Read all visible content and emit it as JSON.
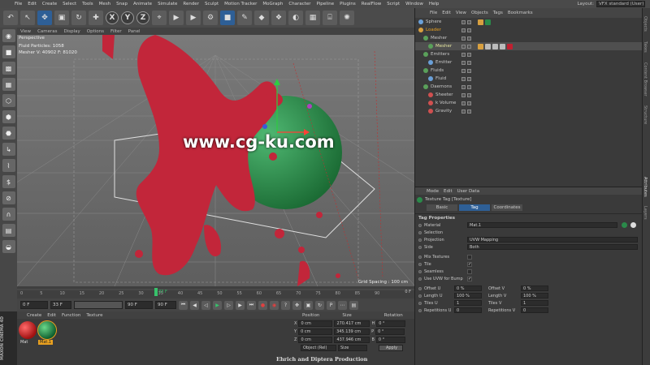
{
  "menu": [
    "File",
    "Edit",
    "Create",
    "Select",
    "Tools",
    "Mesh",
    "Snap",
    "Animate",
    "Simulate",
    "Render",
    "Sculpt",
    "Motion Tracker",
    "MoGraph",
    "Character",
    "Pipeline",
    "Plugins",
    "RealFlow",
    "Script",
    "Window",
    "Help"
  ],
  "layout": {
    "label": "Layout:",
    "value": "VFX standard (User)"
  },
  "viewport": {
    "menu": [
      "View",
      "Cameras",
      "Display",
      "Options",
      "Filter",
      "Panel"
    ],
    "name": "Perspective",
    "stat1": "Fluid Particles: 1058",
    "stat2": "Mesher V: 40902 F: 81020",
    "grid": "Grid Spacing : 100 cm"
  },
  "watermark": "www.cg-ku.com",
  "timeline": {
    "ticks": [
      "0",
      "5",
      "10",
      "15",
      "20",
      "25",
      "30",
      "35",
      "40",
      "45",
      "50",
      "55",
      "60",
      "65",
      "70",
      "75",
      "80",
      "85",
      "90"
    ],
    "current": "33 F",
    "frame": "33 F",
    "start": "0 F",
    "end": "90 F",
    "end2": "90 F",
    "end_display": "0 F"
  },
  "materials": {
    "menu": [
      "Create",
      "Edit",
      "Function",
      "Texture"
    ],
    "items": [
      "Mat",
      "Mat.1"
    ]
  },
  "maxon": "MAXON CINEMA 4D",
  "coords": {
    "headers": [
      "Position",
      "Size",
      "Rotation"
    ],
    "rows": [
      {
        "axis": "X",
        "pos": "0 cm",
        "size": "270.417 cm",
        "rl": "H",
        "rot": "0 °"
      },
      {
        "axis": "Y",
        "pos": "0 cm",
        "size": "345.139 cm",
        "rl": "P",
        "rot": "0 °"
      },
      {
        "axis": "Z",
        "pos": "0 cm",
        "size": "437.946 cm",
        "rl": "B",
        "rot": "0 °"
      }
    ],
    "mode": "Object (Rel)",
    "sizemode": "Size",
    "apply": "Apply"
  },
  "credit": "Ehrich and Diptera Production",
  "objects": {
    "menu": [
      "File",
      "Edit",
      "View",
      "Objects",
      "Tags",
      "Bookmarks"
    ],
    "tree": [
      {
        "name": "Sphere",
        "indent": 0,
        "color": "#6aa0d8"
      },
      {
        "name": "Loader",
        "indent": 0,
        "color": "#d8a040"
      },
      {
        "name": "Mesher",
        "indent": 1,
        "color": "#5aa05a"
      },
      {
        "name": "Mesher",
        "indent": 2,
        "color": "#5aa05a"
      },
      {
        "name": "Emitters",
        "indent": 1,
        "color": "#5aa05a"
      },
      {
        "name": "Emitter",
        "indent": 2,
        "color": "#6aa0d8"
      },
      {
        "name": "Fluids",
        "indent": 1,
        "color": "#5aa05a"
      },
      {
        "name": "Fluid",
        "indent": 2,
        "color": "#6aa0d8"
      },
      {
        "name": "Daemons",
        "indent": 1,
        "color": "#5aa05a"
      },
      {
        "name": "Sheeter",
        "indent": 2,
        "color": "#d05050"
      },
      {
        "name": "k Volume",
        "indent": 2,
        "color": "#d05050"
      },
      {
        "name": "Gravity",
        "indent": 2,
        "color": "#d05050"
      }
    ]
  },
  "side_tabs": [
    "Objects",
    "Takes",
    "Content Browser",
    "Structure",
    "Attributes",
    "Layers"
  ],
  "attributes": {
    "menu": [
      "Mode",
      "Edit",
      "User Data"
    ],
    "title": "Texture Tag [Texture]",
    "tabs": [
      "Basic",
      "Tag",
      "Coordinates"
    ],
    "section": "Tag Properties",
    "material_label": "Material",
    "material_value": "Mat.1",
    "selection_label": "Selection",
    "projection_label": "Projection",
    "projection_value": "UVW Mapping",
    "side_label": "Side",
    "side_value": "Both",
    "mix_label": "Mix Textures",
    "tile_label": "Tile",
    "seamless_label": "Seamless",
    "uvwbump_label": "Use UVW for Bump",
    "offset_u_label": "Offset U",
    "offset_u": "0 %",
    "offset_v_label": "Offset V",
    "offset_v": "0 %",
    "length_u_label": "Length U",
    "length_u": "100 %",
    "length_v_label": "Length V",
    "length_v": "100 %",
    "tiles_u_label": "Tiles U",
    "tiles_u": "1",
    "tiles_v_label": "Tiles V",
    "tiles_v": "1",
    "rep_u_label": "Repetitions U",
    "rep_u": "0",
    "rep_v_label": "Repetitions V",
    "rep_v": "0"
  }
}
